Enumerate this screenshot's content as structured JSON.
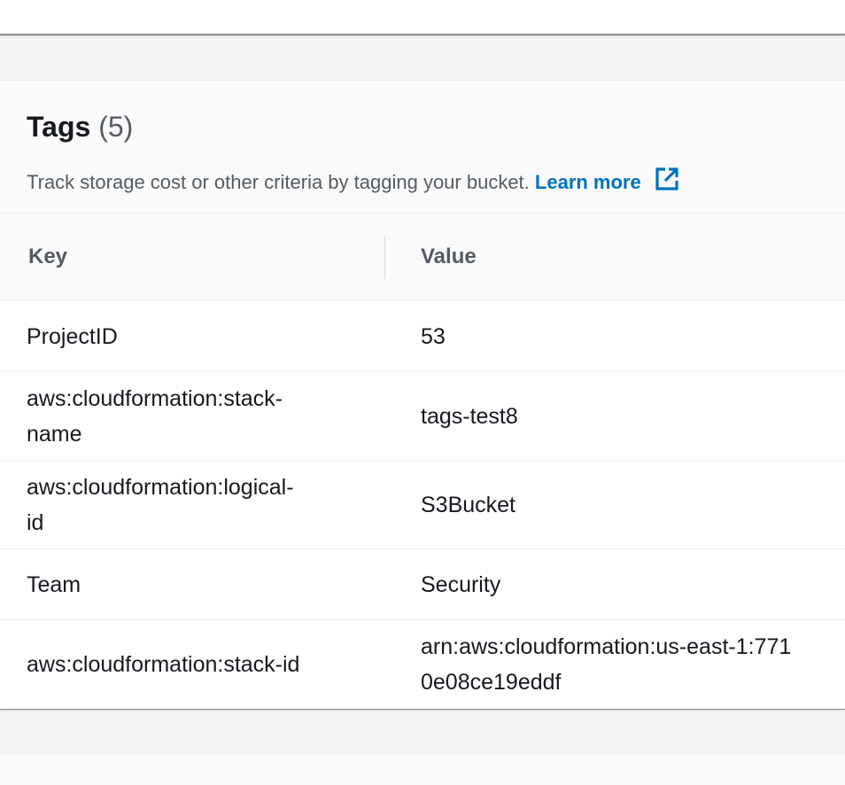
{
  "tags_panel": {
    "title": "Tags",
    "count": "(5)",
    "description": "Track storage cost or other criteria by tagging your bucket.",
    "learn_more": "Learn more",
    "learn_more_icon": "external-link-icon",
    "link_color": "#0073bb"
  },
  "table": {
    "columns": {
      "key": "Key",
      "value": "Value"
    },
    "rows": [
      {
        "key": "ProjectID",
        "value": "53"
      },
      {
        "key": "aws:cloudformation:stack-name",
        "key_line1": "aws:cloudformation:stack-",
        "key_line2": "name",
        "value": "tags-test8"
      },
      {
        "key": "aws:cloudformation:logical-id",
        "key_line1": "aws:cloudformation:logical-",
        "key_line2": "id",
        "value": "S3Bucket"
      },
      {
        "key": "Team",
        "value": "Security"
      },
      {
        "key": "aws:cloudformation:stack-id",
        "value_line1": "arn:aws:cloudformation:us-east-1:771",
        "value_line2": "0e08ce19eddf"
      }
    ]
  }
}
